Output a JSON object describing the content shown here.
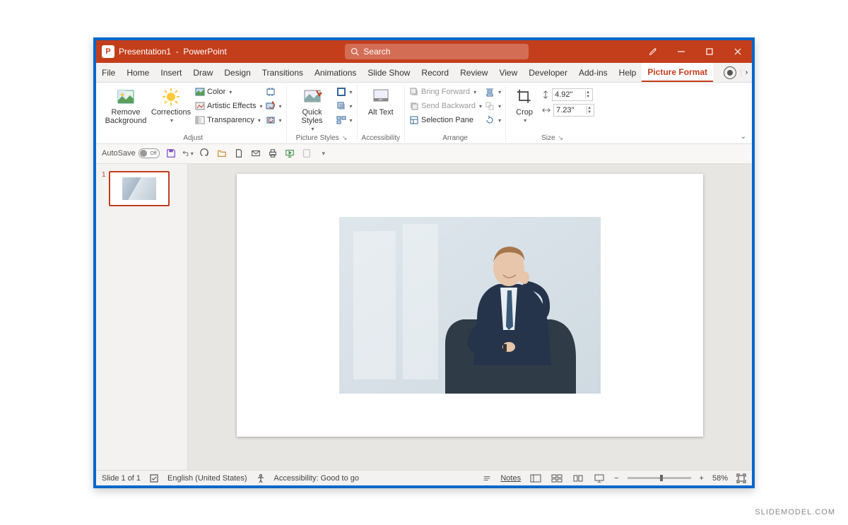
{
  "title": {
    "document": "Presentation1",
    "app": "PowerPoint"
  },
  "search": {
    "placeholder": "Search"
  },
  "tabs": {
    "file": "File",
    "home": "Home",
    "insert": "Insert",
    "draw": "Draw",
    "design": "Design",
    "transitions": "Transitions",
    "animations": "Animations",
    "slideshow": "Slide Show",
    "record": "Record",
    "review": "Review",
    "view": "View",
    "developer": "Developer",
    "addins": "Add-ins",
    "help": "Help",
    "pictureformat": "Picture Format"
  },
  "ribbon": {
    "adjust": {
      "remove_bg": "Remove Background",
      "corrections": "Corrections",
      "color": "Color",
      "artistic": "Artistic Effects",
      "transparency": "Transparency",
      "group": "Adjust"
    },
    "picstyles": {
      "quick": "Quick Styles",
      "group": "Picture Styles"
    },
    "accessibility": {
      "alt": "Alt Text",
      "group": "Accessibility"
    },
    "arrange": {
      "forward": "Bring Forward",
      "backward": "Send Backward",
      "pane": "Selection Pane",
      "group": "Arrange"
    },
    "size": {
      "crop": "Crop",
      "height": "4.92\"",
      "width": "7.23\"",
      "group": "Size"
    }
  },
  "qat": {
    "autosave": "AutoSave",
    "autosave_state": "Off"
  },
  "thumb": {
    "num": "1"
  },
  "status": {
    "slide": "Slide 1 of 1",
    "lang": "English (United States)",
    "accessibility": "Accessibility: Good to go",
    "notes": "Notes",
    "zoom": "58%"
  },
  "watermark": "SLIDEMODEL.COM"
}
